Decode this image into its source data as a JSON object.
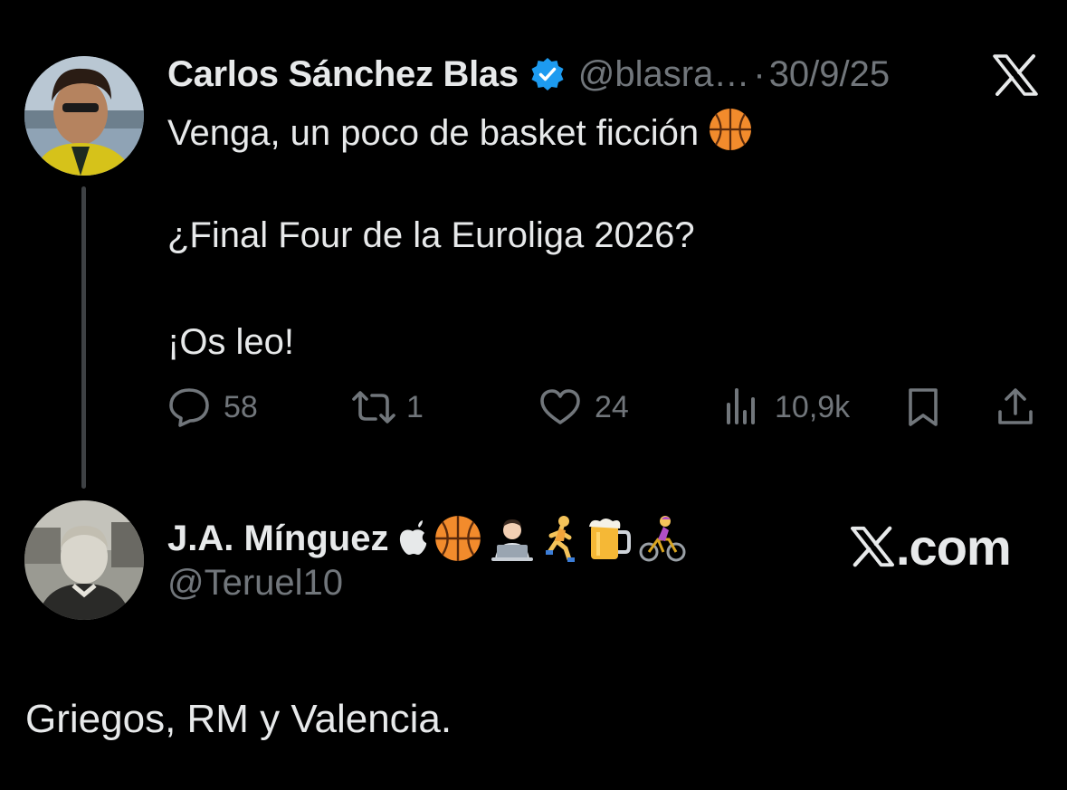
{
  "tweet": {
    "author_name": "Carlos Sánchez Blas",
    "author_handle": "@blasra…",
    "separator": "·",
    "date": "30/9/25",
    "lines": [
      "Venga, un poco de basket ficción",
      "¿Final Four de la Euroliga 2026?",
      "¡Os leo!"
    ],
    "inline_emoji": "basketball-emoji",
    "metrics": {
      "replies": "58",
      "retweets": "1",
      "likes": "24",
      "views": "10,9k"
    }
  },
  "reply": {
    "author_name": "J.A. Mínguez",
    "author_handle": "@Teruel10",
    "name_emojis": [
      "apple-logo",
      "basketball-emoji",
      "technologist-emoji",
      "runner-emoji",
      "beer-emoji",
      "cyclist-emoji"
    ],
    "text": "Griegos, RM y Valencia."
  },
  "watermark": {
    "text": ".com"
  },
  "colors": {
    "background": "#000000",
    "primary_text": "#e7e9ea",
    "secondary_text": "#71767b",
    "verified_blue": "#1d9bf0",
    "thread_line": "#3e4144"
  }
}
